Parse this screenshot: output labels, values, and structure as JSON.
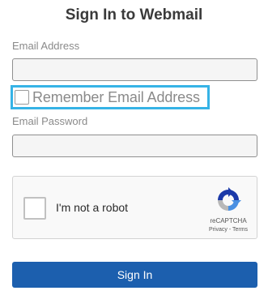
{
  "form": {
    "title": "Sign In to Webmail",
    "email_label": "Email Address",
    "email_value": "",
    "remember_label": "Remember Email Address",
    "remember_checked": false,
    "password_label": "Email Password",
    "password_value": "",
    "submit_label": "Sign In"
  },
  "captcha": {
    "label": "I'm not a robot",
    "brand": "reCAPTCHA",
    "links": "Privacy - Terms",
    "logo_icon": "recaptcha-logo-icon"
  },
  "colors": {
    "focus_outline": "#36b3e6",
    "button": "#1c5fae",
    "text": "#3a3a3a"
  }
}
